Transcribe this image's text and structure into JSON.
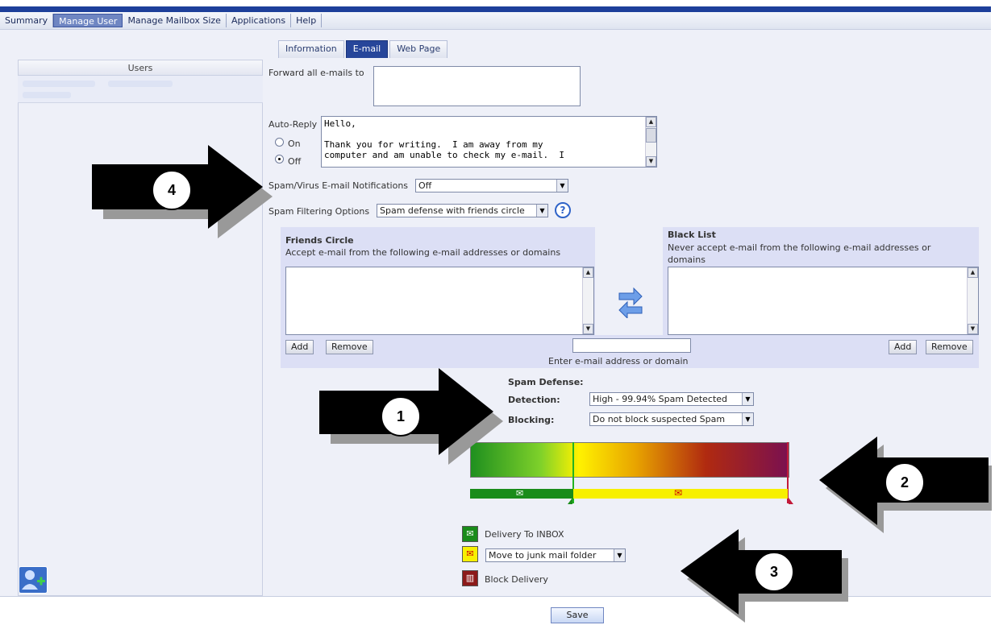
{
  "menu": [
    "Summary",
    "Manage User",
    "Manage Mailbox Size",
    "Applications",
    "Help"
  ],
  "menu_active": 1,
  "tabs": [
    "Information",
    "E-mail",
    "Web Page"
  ],
  "tab_active": 1,
  "left": {
    "header": "Users"
  },
  "forward": {
    "label": "Forward all e-mails to",
    "value": ""
  },
  "autoreply": {
    "label": "Auto-Reply",
    "on_label": "On",
    "off_label": "Off",
    "selected": "Off",
    "text": "Hello,\n\nThank you for writing.  I am away from my\ncomputer and am unable to check my e-mail.  I"
  },
  "notifications": {
    "label": "Spam/Virus E-mail Notifications",
    "value": "Off"
  },
  "filtering": {
    "label": "Spam Filtering Options",
    "value": "Spam defense with friends circle"
  },
  "friends": {
    "title": "Friends Circle",
    "desc": "Accept e-mail from the following e-mail addresses or domains",
    "add": "Add",
    "remove": "Remove"
  },
  "blacklist": {
    "title": "Black List",
    "desc1": "Never accept e-mail from the following e-mail addresses or",
    "desc2": "domains",
    "add": "Add",
    "remove": "Remove"
  },
  "entry": {
    "value": "",
    "caption": "Enter e-mail address or domain"
  },
  "spam": {
    "title": "Spam Defense:",
    "detection_label": "Detection:",
    "detection_value": "High - 99.94% Spam Detected",
    "blocking_label": "Blocking:",
    "blocking_value": "Do not block suspected Spam"
  },
  "legend": {
    "inbox": "Delivery To INBOX",
    "junk_value": "Move to junk mail folder",
    "block": "Block Delivery"
  },
  "save": "Save",
  "callouts": [
    "1",
    "2",
    "3",
    "4"
  ],
  "colors": {
    "brand": "#1d3f9a",
    "tab_active": "#27469a",
    "panel": "#eef0f8",
    "box": "#dcdff5"
  }
}
